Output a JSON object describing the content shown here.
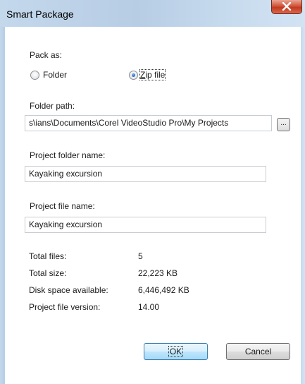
{
  "window": {
    "title": "Smart Package"
  },
  "pack_as": {
    "label": "Pack as:",
    "options": [
      {
        "label": "Folder",
        "selected": false
      },
      {
        "label": "Zip file",
        "selected": true
      }
    ]
  },
  "folder_path": {
    "label": "Folder path:",
    "value": "s\\ians\\Documents\\Corel VideoStudio Pro\\My Projects",
    "browse_label": "..."
  },
  "project_folder_name": {
    "label": "Project folder name:",
    "value": "Kayaking excursion"
  },
  "project_file_name": {
    "label": "Project file name:",
    "value": "Kayaking excursion"
  },
  "info": [
    {
      "label": "Total files:",
      "value": "5"
    },
    {
      "label": "Total size:",
      "value": "22,223 KB"
    },
    {
      "label": "Disk space available:",
      "value": "6,446,492 KB"
    },
    {
      "label": "Project file version:",
      "value": "14.00"
    }
  ],
  "buttons": {
    "ok": "OK",
    "cancel": "Cancel"
  },
  "colors": {
    "title_bar": "#c4d8ec",
    "close_button": "#c2391f",
    "default_button_border": "#3c7fb1"
  }
}
